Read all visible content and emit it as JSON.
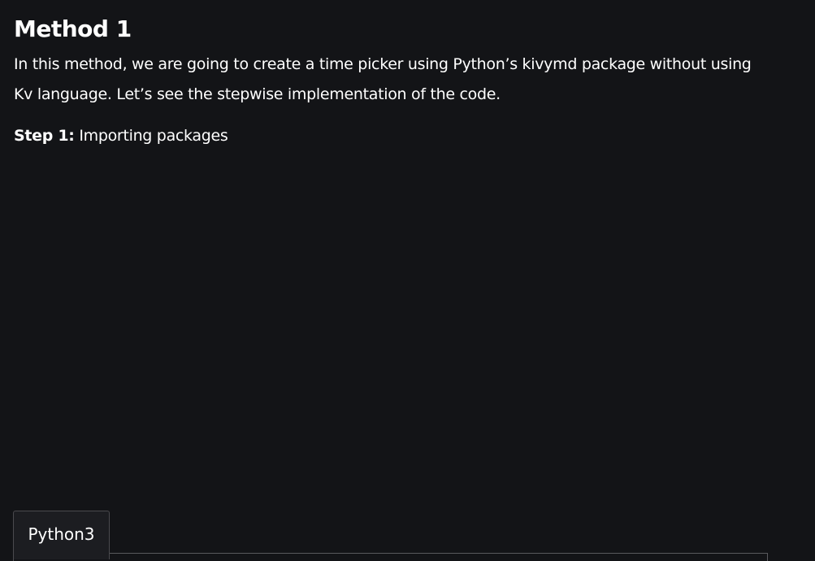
{
  "article": {
    "heading": "Method 1",
    "intro": "In this method, we are going to create a time picker using Python’s kivymd package without using Kv language. Let’s see the stepwise implementation of the code.",
    "step": {
      "label": "Step 1:",
      "text": " Importing packages"
    }
  },
  "code_block": {
    "tabs": [
      {
        "label": "Python3",
        "active": true
      }
    ]
  },
  "colors": {
    "background": "#131417",
    "text": "#ffffff",
    "tab_background": "#1c1d21",
    "tab_border": "#4a4a4e"
  }
}
